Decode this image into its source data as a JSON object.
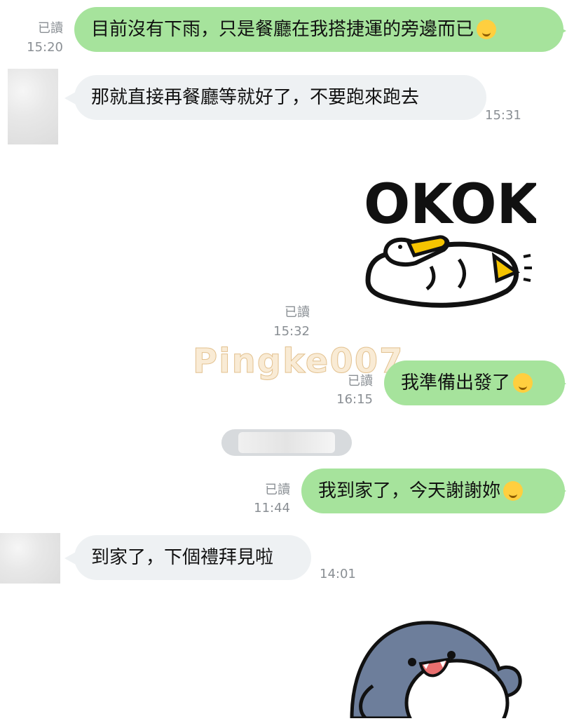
{
  "messages": [
    {
      "direction": "out",
      "read": "已讀",
      "time": "15:20",
      "text": "目前沒有下雨，只是餐廳在我搭捷運的旁邊而已",
      "emoji": "rofl-emoji"
    },
    {
      "direction": "in",
      "time": "15:31",
      "text": "那就直接再餐廳等就好了，不要跑來跑去"
    },
    {
      "direction": "out",
      "read": "已讀",
      "time": "15:32",
      "sticker_text": "OKOK"
    },
    {
      "direction": "out",
      "read": "已讀",
      "time": "16:15",
      "text": "我準備出發了",
      "emoji": "smile-emoji"
    },
    {
      "direction": "out",
      "read": "已讀",
      "time": "11:44",
      "text": "我到家了，今天謝謝妳",
      "emoji": "smiling-hearts-emoji"
    },
    {
      "direction": "in",
      "time": "14:01",
      "text": "到家了，下個禮拜見啦"
    }
  ],
  "watermark": "Pingke007",
  "colors": {
    "outgoing": "#a6e39c",
    "incoming": "#eef1f3",
    "meta": "#8a8f94"
  }
}
